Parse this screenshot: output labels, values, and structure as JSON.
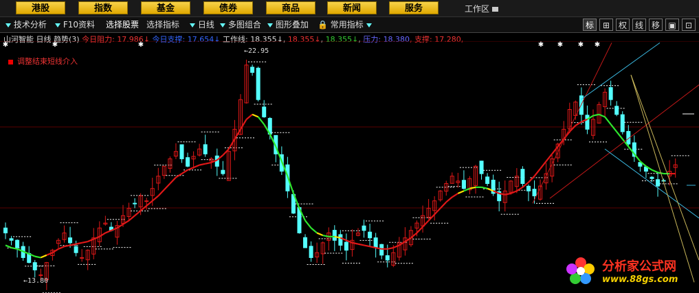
{
  "top_menu": [
    "港股",
    "指数",
    "基金",
    "债券",
    "商品",
    "新闻",
    "服务"
  ],
  "workarea": "工作区",
  "toolbar": {
    "items": [
      "技术分析",
      "F10资料",
      "选择股票",
      "选择指标",
      "日线",
      "多图组合",
      "图形叠加",
      "常用指标"
    ],
    "right_buttons": [
      "标",
      "⊞",
      "权",
      "线",
      "移",
      "▣",
      "⊡"
    ]
  },
  "info": {
    "name": "山河智能",
    "period": "日线",
    "trend": "趋势(3)",
    "resistance_label": "今日阻力:",
    "resistance_value": "17.986",
    "support_label": "今日支撑:",
    "support_value": "17.654",
    "workline_label": "工作线:",
    "workline_value1": "18.355",
    "workline_value2": "18.355",
    "workline_value3": "18.355",
    "pressure_label": "压力:",
    "pressure_value": "18.380",
    "support2_label": "支撑:",
    "support2_value": "17.280,"
  },
  "legend": "调整结束短线介入",
  "chart_data": {
    "type": "candlestick",
    "y_high_label": "22.95",
    "y_low_label": "13.80",
    "close": [
      15.6,
      15.3,
      15.0,
      14.6,
      14.4,
      14.1,
      13.9,
      14.4,
      14.9,
      15.3,
      15.6,
      15.2,
      14.8,
      14.6,
      14.9,
      15.4,
      15.8,
      16.0,
      15.7,
      15.9,
      16.3,
      16.6,
      16.8,
      17.1,
      16.9,
      17.4,
      17.9,
      18.3,
      18.6,
      18.9,
      18.6,
      18.3,
      18.7,
      19.0,
      18.8,
      18.6,
      18.3,
      18.0,
      18.9,
      19.8,
      21.0,
      22.4,
      22.1,
      21.0,
      20.3,
      19.6,
      18.8,
      18.1,
      17.3,
      16.4,
      15.6,
      15.0,
      14.6,
      14.8,
      15.2,
      15.6,
      15.3,
      15.1,
      14.9,
      15.3,
      15.6,
      15.7,
      15.4,
      15.0,
      14.7,
      14.5,
      14.8,
      15.2,
      15.4,
      15.7,
      16.0,
      16.3,
      16.6,
      16.9,
      17.3,
      17.6,
      17.9,
      17.7,
      17.4,
      17.8,
      18.3,
      18.0,
      17.6,
      17.2,
      16.9,
      17.3,
      17.7,
      17.9,
      17.6,
      17.3,
      17.1,
      17.5,
      18.0,
      18.6,
      19.2,
      19.8,
      20.6,
      20.9,
      20.4,
      19.8,
      20.2,
      20.8,
      21.3,
      21.0,
      20.4,
      19.7,
      19.2,
      18.7,
      18.3,
      18.1,
      17.8,
      17.5,
      17.7,
      18.1,
      18.36
    ],
    "indicator_line": [
      15.1,
      15.0,
      14.95,
      14.85,
      14.75,
      14.65,
      14.6,
      14.7,
      14.8,
      14.95,
      15.05,
      15.1,
      15.15,
      15.2,
      15.25,
      15.35,
      15.45,
      15.6,
      15.7,
      15.8,
      15.95,
      16.1,
      16.3,
      16.5,
      16.7,
      16.9,
      17.1,
      17.35,
      17.6,
      17.85,
      18.0,
      18.15,
      18.25,
      18.35,
      18.4,
      18.45,
      18.55,
      18.75,
      19.0,
      19.4,
      19.8,
      20.2,
      20.4,
      20.3,
      20.0,
      19.6,
      19.1,
      18.5,
      17.9,
      17.2,
      16.6,
      16.1,
      15.8,
      15.6,
      15.5,
      15.45,
      15.45,
      15.4,
      15.3,
      15.2,
      15.15,
      15.1,
      15.05,
      15.0,
      14.95,
      14.95,
      15.0,
      15.1,
      15.25,
      15.4,
      15.6,
      15.85,
      16.1,
      16.35,
      16.6,
      16.85,
      17.05,
      17.2,
      17.3,
      17.4,
      17.45,
      17.45,
      17.4,
      17.3,
      17.2,
      17.15,
      17.2,
      17.3,
      17.45,
      17.65,
      17.9,
      18.2,
      18.5,
      18.8,
      19.1,
      19.4,
      19.7,
      19.95,
      20.1,
      20.2,
      20.35,
      20.4,
      20.3,
      20.0,
      19.7,
      19.4,
      19.1,
      18.8,
      18.5,
      18.3,
      18.15,
      18.05,
      18.0,
      18.0,
      18.0
    ],
    "indicator_trend": [
      "green",
      "green",
      "green",
      "green",
      "green",
      "green",
      "yellow",
      "red",
      "red",
      "red",
      "red",
      "red",
      "red",
      "red",
      "red",
      "red",
      "red",
      "red",
      "red",
      "red",
      "red",
      "red",
      "red",
      "red",
      "red",
      "red",
      "red",
      "red",
      "red",
      "red",
      "red",
      "red",
      "red",
      "red",
      "red",
      "red",
      "red",
      "red",
      "red",
      "red",
      "red",
      "red",
      "yellow",
      "green",
      "green",
      "green",
      "green",
      "green",
      "green",
      "green",
      "green",
      "green",
      "green",
      "yellow",
      "green",
      "green",
      "yellow",
      "red",
      "red",
      "red",
      "red",
      "red",
      "red",
      "red",
      "red",
      "red",
      "red",
      "red",
      "red",
      "red",
      "red",
      "red",
      "red",
      "red",
      "red",
      "red",
      "red",
      "yellow",
      "green",
      "yellow",
      "green",
      "green",
      "yellow",
      "red",
      "red",
      "red",
      "red",
      "red",
      "red",
      "red",
      "red",
      "red",
      "red",
      "red",
      "red",
      "red",
      "red",
      "red",
      "red",
      "green",
      "green",
      "green",
      "green",
      "green",
      "green",
      "green",
      "green",
      "green",
      "green",
      "green",
      "green",
      "green",
      "green"
    ]
  },
  "logo": {
    "title": "分析家公式网",
    "url": "www.88gs.com"
  }
}
